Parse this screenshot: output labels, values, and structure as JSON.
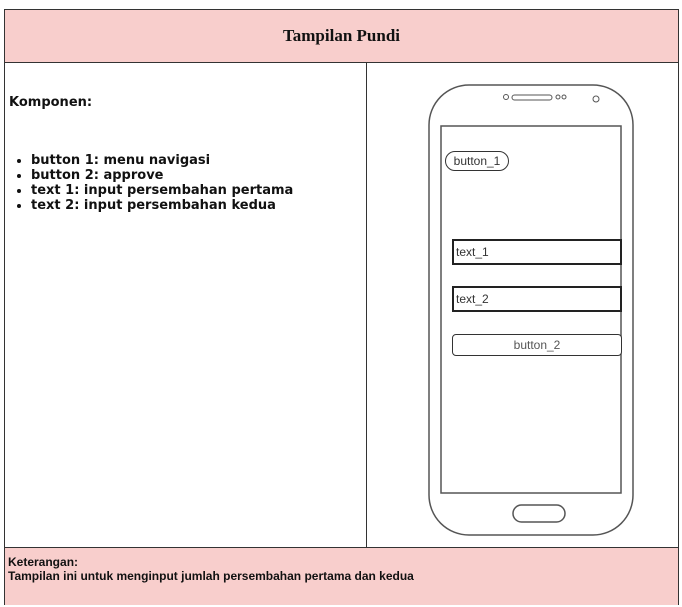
{
  "title": "Tampilan Pundi",
  "components": {
    "heading": "Komponen:",
    "items": [
      "button 1: menu navigasi",
      "button 2: approve",
      "text 1: input persembahan pertama",
      "text 2: input persembahan kedua"
    ]
  },
  "mockup": {
    "button_1": "button_1",
    "text_1": "text_1",
    "text_2": "text_2",
    "button_2": "button_2"
  },
  "footer": {
    "label": "Keterangan:",
    "description": "Tampilan ini untuk menginput jumlah persembahan pertama dan kedua"
  },
  "colors": {
    "header_bg": "#f8cecc",
    "border": "#333333"
  }
}
